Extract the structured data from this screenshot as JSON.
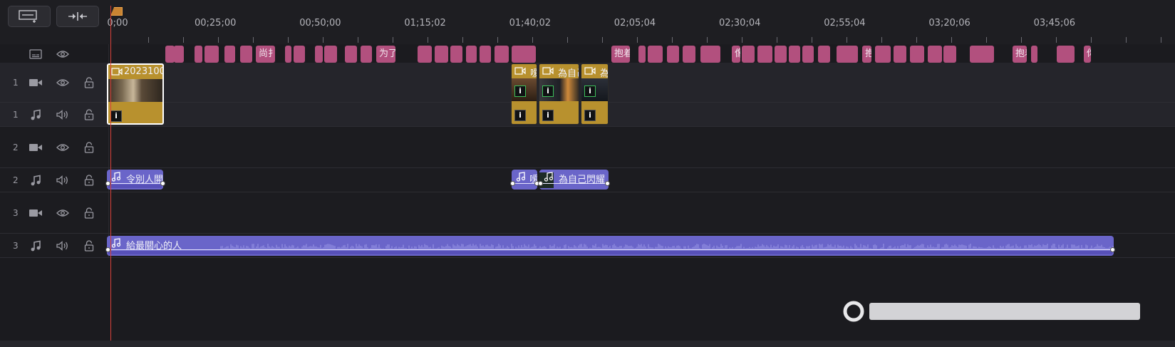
{
  "toolbar": {
    "add_track_icon": "add-track-icon",
    "split_icon": "split-icon"
  },
  "ruler": {
    "labels": [
      "0;00",
      "00;25;00",
      "00;50;00",
      "01;15;02",
      "01;40;02",
      "02;05;04",
      "02;30;04",
      "02;55;04",
      "03;20;06",
      "03;45;06"
    ]
  },
  "subtitle_track": {
    "clips": [
      {
        "text": ""
      },
      {
        "text": ""
      },
      {
        "text": ""
      },
      {
        "text": ""
      },
      {
        "text": ""
      },
      {
        "text": ""
      },
      {
        "text": "尚扌"
      },
      {
        "text": ""
      },
      {
        "text": ""
      },
      {
        "text": ""
      },
      {
        "text": ""
      },
      {
        "text": ""
      },
      {
        "text": ""
      },
      {
        "text": "为了"
      },
      {
        "text": ""
      },
      {
        "text": ""
      },
      {
        "text": ""
      },
      {
        "text": ""
      },
      {
        "text": ""
      },
      {
        "text": ""
      },
      {
        "text": ""
      },
      {
        "text": "抱着"
      },
      {
        "text": ""
      },
      {
        "text": ""
      },
      {
        "text": ""
      },
      {
        "text": ""
      },
      {
        "text": ""
      },
      {
        "text": "像伤"
      },
      {
        "text": ""
      },
      {
        "text": ""
      },
      {
        "text": ""
      },
      {
        "text": ""
      },
      {
        "text": ""
      },
      {
        "text": ""
      },
      {
        "text": ""
      },
      {
        "text": "抱着"
      },
      {
        "text": ""
      },
      {
        "text": ""
      },
      {
        "text": ""
      },
      {
        "text": ""
      },
      {
        "text": ""
      },
      {
        "text": ""
      },
      {
        "text": "抱着"
      },
      {
        "text": ""
      },
      {
        "text": ""
      },
      {
        "text": "你[ "
      },
      {
        "text": ""
      }
    ]
  },
  "tracks": [
    {
      "num": "1",
      "kind": "video"
    },
    {
      "num": "1",
      "kind": "audio"
    },
    {
      "num": "2",
      "kind": "video"
    },
    {
      "num": "2",
      "kind": "audio"
    },
    {
      "num": "3",
      "kind": "video"
    },
    {
      "num": "3",
      "kind": "audio"
    }
  ],
  "video_clips": [
    {
      "label": "2023100"
    },
    {
      "label": "嗳"
    },
    {
      "label": "為自己"
    },
    {
      "label": "為"
    }
  ],
  "audio_clips_track2": [
    {
      "label": "令別人開"
    },
    {
      "label": "嗳"
    },
    {
      "label": "為自己閃耀"
    }
  ],
  "audio_clips_track3": [
    {
      "label": "給最關心的人"
    }
  ],
  "colors": {
    "subtitle": "#b2507e",
    "video_clip": "#b8912e",
    "audio_clip": "#6a65c9",
    "playhead": "#d8413a"
  }
}
